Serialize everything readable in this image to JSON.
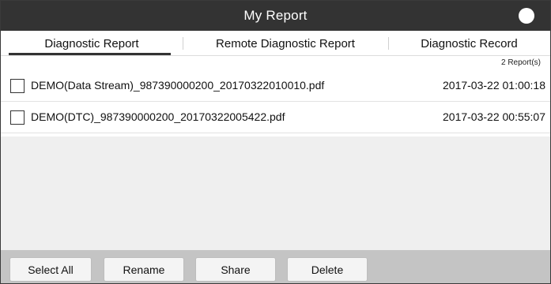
{
  "header": {
    "title": "My Report",
    "menu_icon": "circle-menu-icon"
  },
  "tabs": [
    {
      "label": "Diagnostic Report",
      "active": true
    },
    {
      "label": "Remote Diagnostic Report",
      "active": false
    },
    {
      "label": "Diagnostic Record",
      "active": false
    }
  ],
  "report_count": "2 Report(s)",
  "reports": [
    {
      "name": "DEMO(Data Stream)_987390000200_20170322010010.pdf",
      "date": "2017-03-22 01:00:18",
      "checked": false
    },
    {
      "name": "DEMO(DTC)_987390000200_20170322005422.pdf",
      "date": "2017-03-22 00:55:07",
      "checked": false
    }
  ],
  "actions": {
    "select_all": "Select All",
    "rename": "Rename",
    "share": "Share",
    "delete": "Delete"
  },
  "colors": {
    "titlebar_bg": "#333333",
    "bottombar_bg": "#c4c4c4",
    "empty_area_bg": "#efefef"
  }
}
